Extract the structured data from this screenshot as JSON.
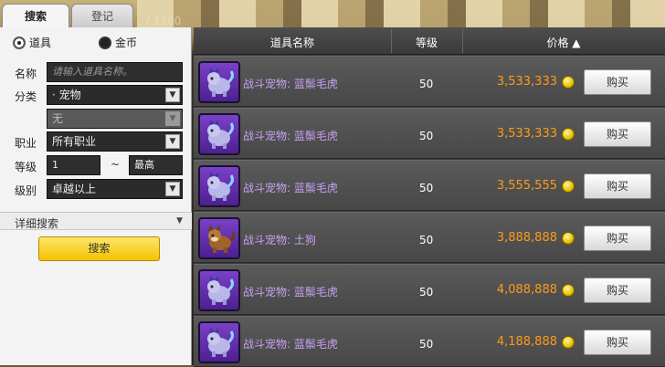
{
  "background": {
    "faint_text": "/ 1100"
  },
  "tabs": [
    {
      "label": "搜索",
      "active": true
    },
    {
      "label": "登记",
      "active": false
    }
  ],
  "filter": {
    "currency_options": [
      {
        "label": "道具",
        "selected": true
      },
      {
        "label": "金币",
        "selected": false
      }
    ],
    "name_label": "名称",
    "name_placeholder": "请输入道具名称。",
    "category_label": "分类",
    "category_value": "· 宠物",
    "subcategory_value": "无",
    "job_label": "职业",
    "job_value": "所有职业",
    "level_label": "等级",
    "level_min": "1",
    "level_sep": "~",
    "level_max": "最高",
    "grade_label": "级别",
    "grade_value": "卓越以上",
    "detail_label": "详细搜索",
    "detail_arrow": "▼",
    "search_button": "搜索"
  },
  "table": {
    "headers": {
      "name": "道具名称",
      "level": "等级",
      "price": "价格 ▲"
    },
    "rows": [
      {
        "name": "战斗宠物: 蓝鬃毛虎",
        "level": "50",
        "price": "3,533,333",
        "buy": "购买",
        "icon": "blue-tiger-pet-icon"
      },
      {
        "name": "战斗宠物: 蓝鬃毛虎",
        "level": "50",
        "price": "3,533,333",
        "buy": "购买",
        "icon": "blue-tiger-pet-icon"
      },
      {
        "name": "战斗宠物: 蓝鬃毛虎",
        "level": "50",
        "price": "3,555,555",
        "buy": "购买",
        "icon": "blue-tiger-pet-icon"
      },
      {
        "name": "战斗宠物: 土狗",
        "level": "50",
        "price": "3,888,888",
        "buy": "购买",
        "icon": "brown-dog-pet-icon"
      },
      {
        "name": "战斗宠物: 蓝鬃毛虎",
        "level": "50",
        "price": "4,088,888",
        "buy": "购买",
        "icon": "blue-tiger-pet-icon"
      },
      {
        "name": "战斗宠物: 蓝鬃毛虎",
        "level": "50",
        "price": "4,188,888",
        "buy": "购买",
        "icon": "blue-tiger-pet-icon"
      }
    ]
  },
  "colors": {
    "price": "#ff9a1a",
    "item_name": "#c8a0f2",
    "search_button": "#f2c200"
  }
}
